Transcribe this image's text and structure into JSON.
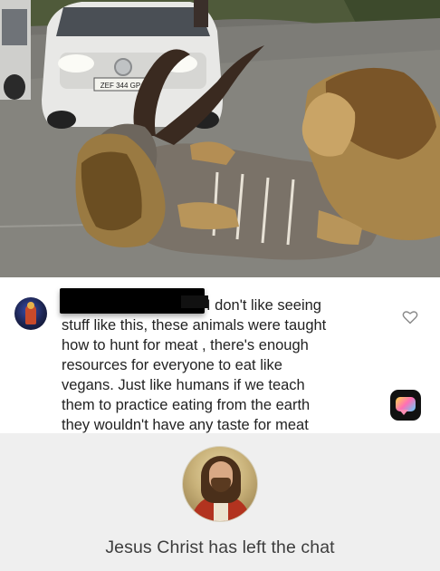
{
  "post": {
    "comment_lines": [
      "I don't like seeing",
      "stuff like this, these animals were taught",
      "how to hunt for meat , there's enough",
      "resources for everyone to eat like",
      "vegans. Just like humans if we teach",
      "them to practice eating from the earth",
      "they wouldn't have any taste for meat"
    ],
    "plate_text": "ZEF 344 GP"
  },
  "footer": {
    "status_text": "Jesus Christ has left the chat"
  },
  "icons": {
    "like": "heart-outline-icon",
    "app": "chat-app-badge-icon"
  },
  "colors": {
    "comment_text": "#222222",
    "footer_bg": "#efefef",
    "footer_text": "#3d3d3d",
    "heart": "#8a8a8a"
  }
}
